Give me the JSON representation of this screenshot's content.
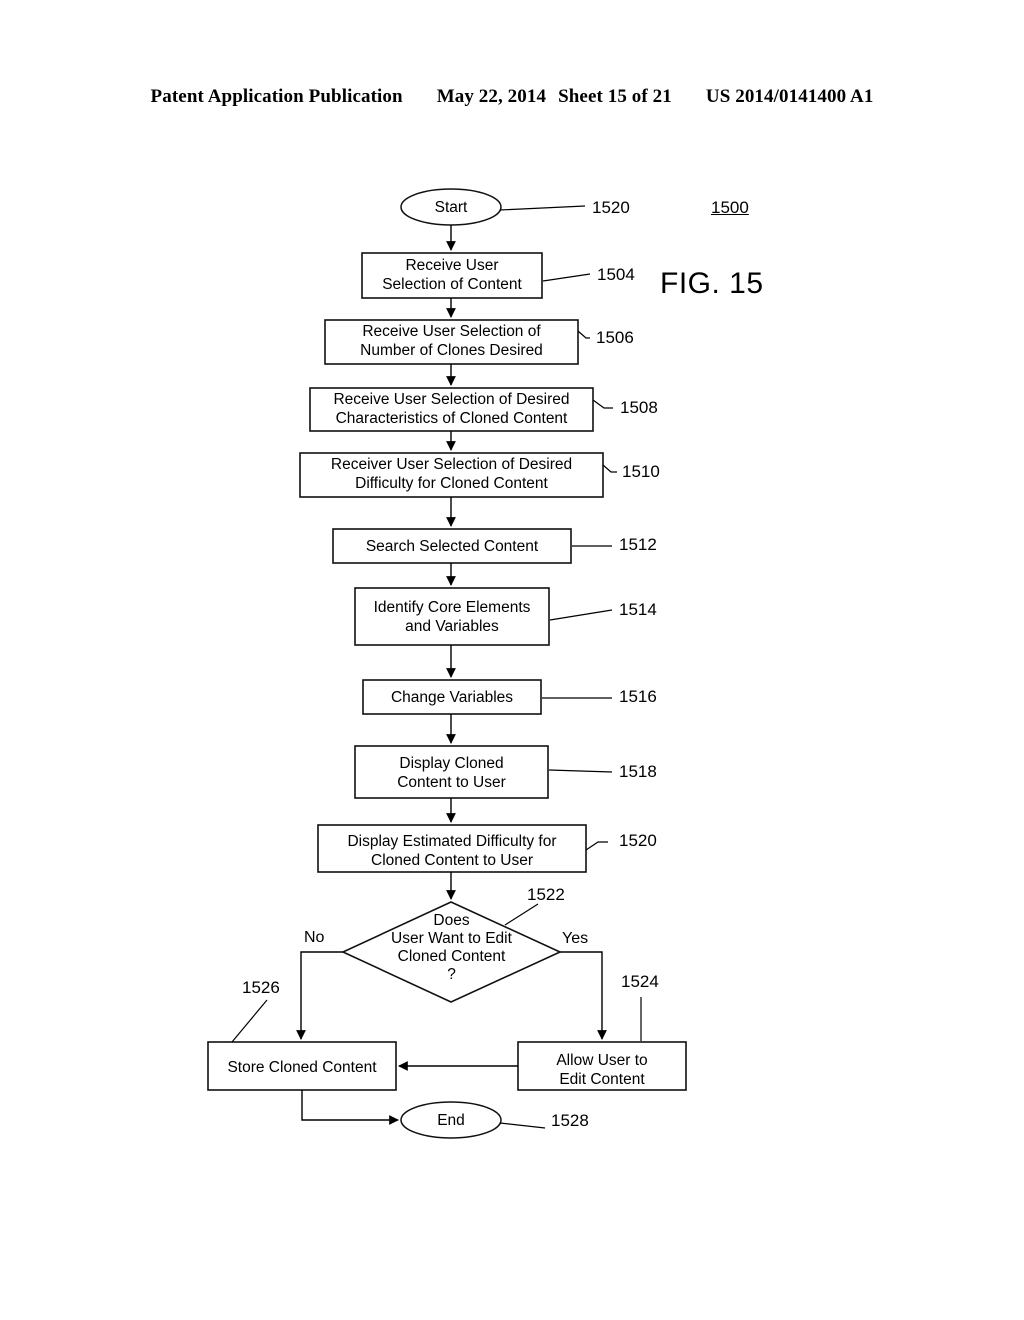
{
  "header": {
    "publication": "Patent Application Publication",
    "date": "May 22, 2014",
    "sheet": "Sheet 15 of 21",
    "patent_number": "US 2014/0141400 A1"
  },
  "figure": {
    "label": "FIG. 15",
    "diagram_ref": "1500"
  },
  "flowchart": {
    "type": "flowchart",
    "nodes": [
      {
        "id": "start",
        "shape": "ellipse",
        "text": "Start",
        "ref": "1520"
      },
      {
        "id": "n1504",
        "shape": "rect",
        "text": "Receive User\nSelection of Content",
        "ref": "1504"
      },
      {
        "id": "n1506",
        "shape": "rect",
        "text": "Receive User Selection of\nNumber of Clones Desired",
        "ref": "1506"
      },
      {
        "id": "n1508",
        "shape": "rect",
        "text": "Receive User Selection of Desired\nCharacteristics of Cloned Content",
        "ref": "1508"
      },
      {
        "id": "n1510",
        "shape": "rect",
        "text": "Receiver User Selection of Desired\nDifficulty for Cloned Content",
        "ref": "1510"
      },
      {
        "id": "n1512",
        "shape": "rect",
        "text": "Search Selected Content",
        "ref": "1512"
      },
      {
        "id": "n1514",
        "shape": "rect",
        "text": "Identify Core Elements\nand Variables",
        "ref": "1514"
      },
      {
        "id": "n1516",
        "shape": "rect",
        "text": "Change Variables",
        "ref": "1516"
      },
      {
        "id": "n1518",
        "shape": "rect",
        "text": "Display Cloned\nContent to User",
        "ref": "1518"
      },
      {
        "id": "n1520",
        "shape": "rect",
        "text": "Display Estimated Difficulty for\nCloned Content to User",
        "ref": "1520"
      },
      {
        "id": "n1522",
        "shape": "diamond",
        "text": "Does\nUser Want to Edit\nCloned Content\n?",
        "ref": "1522"
      },
      {
        "id": "n1524",
        "shape": "rect",
        "text": "Allow User to\nEdit Content",
        "ref": "1524"
      },
      {
        "id": "n1526",
        "shape": "rect",
        "text": "Store Cloned Content",
        "ref": "1526"
      },
      {
        "id": "end",
        "shape": "ellipse",
        "text": "End",
        "ref": "1528"
      }
    ],
    "branch_labels": {
      "no": "No",
      "yes": "Yes"
    }
  },
  "colors": {
    "ink": "#000000",
    "paper": "#ffffff"
  }
}
